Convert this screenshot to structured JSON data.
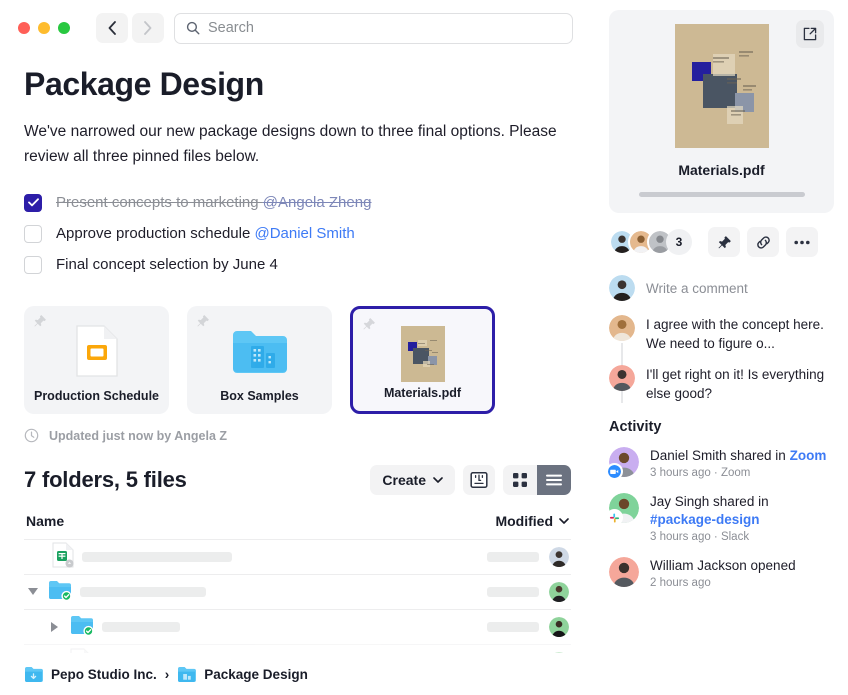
{
  "window": {
    "traffic_lights": [
      "close",
      "minimize",
      "maximize"
    ],
    "back_label": "Back",
    "forward_label": "Forward"
  },
  "search": {
    "placeholder": "Search",
    "value": ""
  },
  "page": {
    "title": "Package Design",
    "description": "We've narrowed our new package designs down to three final options. Please review all three pinned files below."
  },
  "tasks": [
    {
      "label": "Present concepts to marketing ",
      "mention": "@Angela Zheng",
      "checked": true
    },
    {
      "label": "Approve production schedule ",
      "mention": "@Daniel Smith",
      "checked": false
    },
    {
      "label": "Final concept selection by June 4",
      "mention": "",
      "checked": false
    }
  ],
  "pinned_cards": [
    {
      "name": "Production Schedule",
      "icon": "slides-file-icon",
      "selected": false
    },
    {
      "name": "Box Samples",
      "icon": "folder-icon",
      "selected": false
    },
    {
      "name": "Materials.pdf",
      "icon": "pdf-thumbnail-icon",
      "selected": true
    }
  ],
  "updated_text": "Updated just now by Angela Z",
  "file_list": {
    "count_label": "7 folders, 5 files",
    "create_label": "Create",
    "columns": {
      "name": "Name",
      "modified": "Modified"
    },
    "rows": [
      {
        "icon": "google-sheets-file-icon",
        "indent": 0,
        "twisty": "none",
        "name_width": 150,
        "mod_width": 52
      },
      {
        "icon": "shared-folder-icon",
        "indent": 0,
        "twisty": "expanded",
        "name_width": 126,
        "mod_width": 52
      },
      {
        "icon": "shared-folder-icon",
        "indent": 1,
        "twisty": "collapsed",
        "name_width": 78,
        "mod_width": 52
      },
      {
        "icon": "file-icon",
        "indent": 2,
        "twisty": "none",
        "name_width": 118,
        "mod_width": 52
      }
    ]
  },
  "breadcrumb": [
    {
      "label": "Pepo Studio Inc.",
      "icon": "team-folder-icon"
    },
    {
      "label": "Package Design",
      "icon": "folder-icon"
    }
  ],
  "sidebar": {
    "preview": {
      "file_name": "Materials.pdf",
      "open_label": "Open in new window"
    },
    "members_count": "3",
    "action_buttons": [
      {
        "name": "pin-button",
        "icon": "pin-icon"
      },
      {
        "name": "copy-link-button",
        "icon": "link-icon"
      },
      {
        "name": "more-button",
        "icon": "ellipsis-icon"
      }
    ],
    "comment_placeholder": "Write a comment",
    "comments": [
      {
        "text": "I agree with the concept here. We need to figure o..."
      },
      {
        "text": "I'll get right on it! Is everything else good?"
      }
    ],
    "activity_title": "Activity",
    "activity": [
      {
        "actor": "Daniel Smith",
        "action": " shared in ",
        "target": "Zoom",
        "meta": "3 hours ago · Zoom",
        "badge": "zoom-icon"
      },
      {
        "actor": "Jay Singh",
        "action": " shared in ",
        "target": "#package-design",
        "meta": "3 hours ago · Slack",
        "badge": "slack-icon"
      },
      {
        "actor": "William Jackson",
        "action": " opened",
        "target": "",
        "meta": "2 hours ago",
        "badge": ""
      }
    ]
  },
  "colors": {
    "accent": "#2d1ea8",
    "link": "#3d7af5",
    "text": "#1a1d29",
    "muted": "#8b8e95"
  }
}
